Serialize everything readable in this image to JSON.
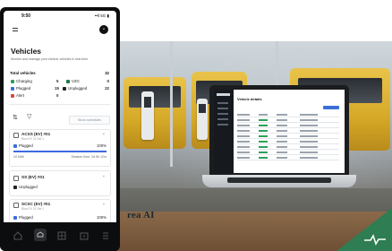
{
  "phone": {
    "status_time": "9:50",
    "status_right": "••ll 5G ▮",
    "avatar_initial": "•",
    "title": "Vehicles",
    "subtitle": "Monitor and manage your electric vehicles in real-time",
    "summary": {
      "total_label": "Total vehicles",
      "total_value": "32",
      "stats": [
        {
          "label": "Charging",
          "value": "5",
          "color": "#2ea05a"
        },
        {
          "label": "V2G",
          "value": "0",
          "color": "#1e7a4f"
        },
        {
          "label": "Plugged",
          "value": "15",
          "color": "#3d6be0"
        },
        {
          "label": "Unplugged",
          "value": "22",
          "color": "#222222"
        },
        {
          "label": "Alert",
          "value": "0",
          "color": "#e0443d"
        }
      ]
    },
    "toolbar": {
      "sort_icon": "⇅",
      "filter_icon": "▽",
      "schedule_button": "Show schedules"
    },
    "vehicles": [
      {
        "name": "ACSS (EV) #01",
        "meta": "Blue EV 21 Set 1",
        "status": "Plugged",
        "percent": "100%",
        "percent_value": 100,
        "distance": "10 kWh",
        "session": "Session time: 2d 5h 12m"
      },
      {
        "name": "SS (EV) #01",
        "status": "Unplugged"
      },
      {
        "name": "SCSC (EV) #01",
        "meta": "Blue EV 21 Set 1",
        "status": "Plugged",
        "percent": "100%"
      }
    ],
    "tabs": [
      "home-icon",
      "vehicles-icon",
      "chargers-icon",
      "schedule-icon",
      "reports-icon"
    ]
  },
  "brand_text": "rea AI",
  "laptop": {
    "title": "Vehicle details"
  },
  "colors": {
    "accent": "#3d6be0",
    "corner": "#2f7d52"
  }
}
